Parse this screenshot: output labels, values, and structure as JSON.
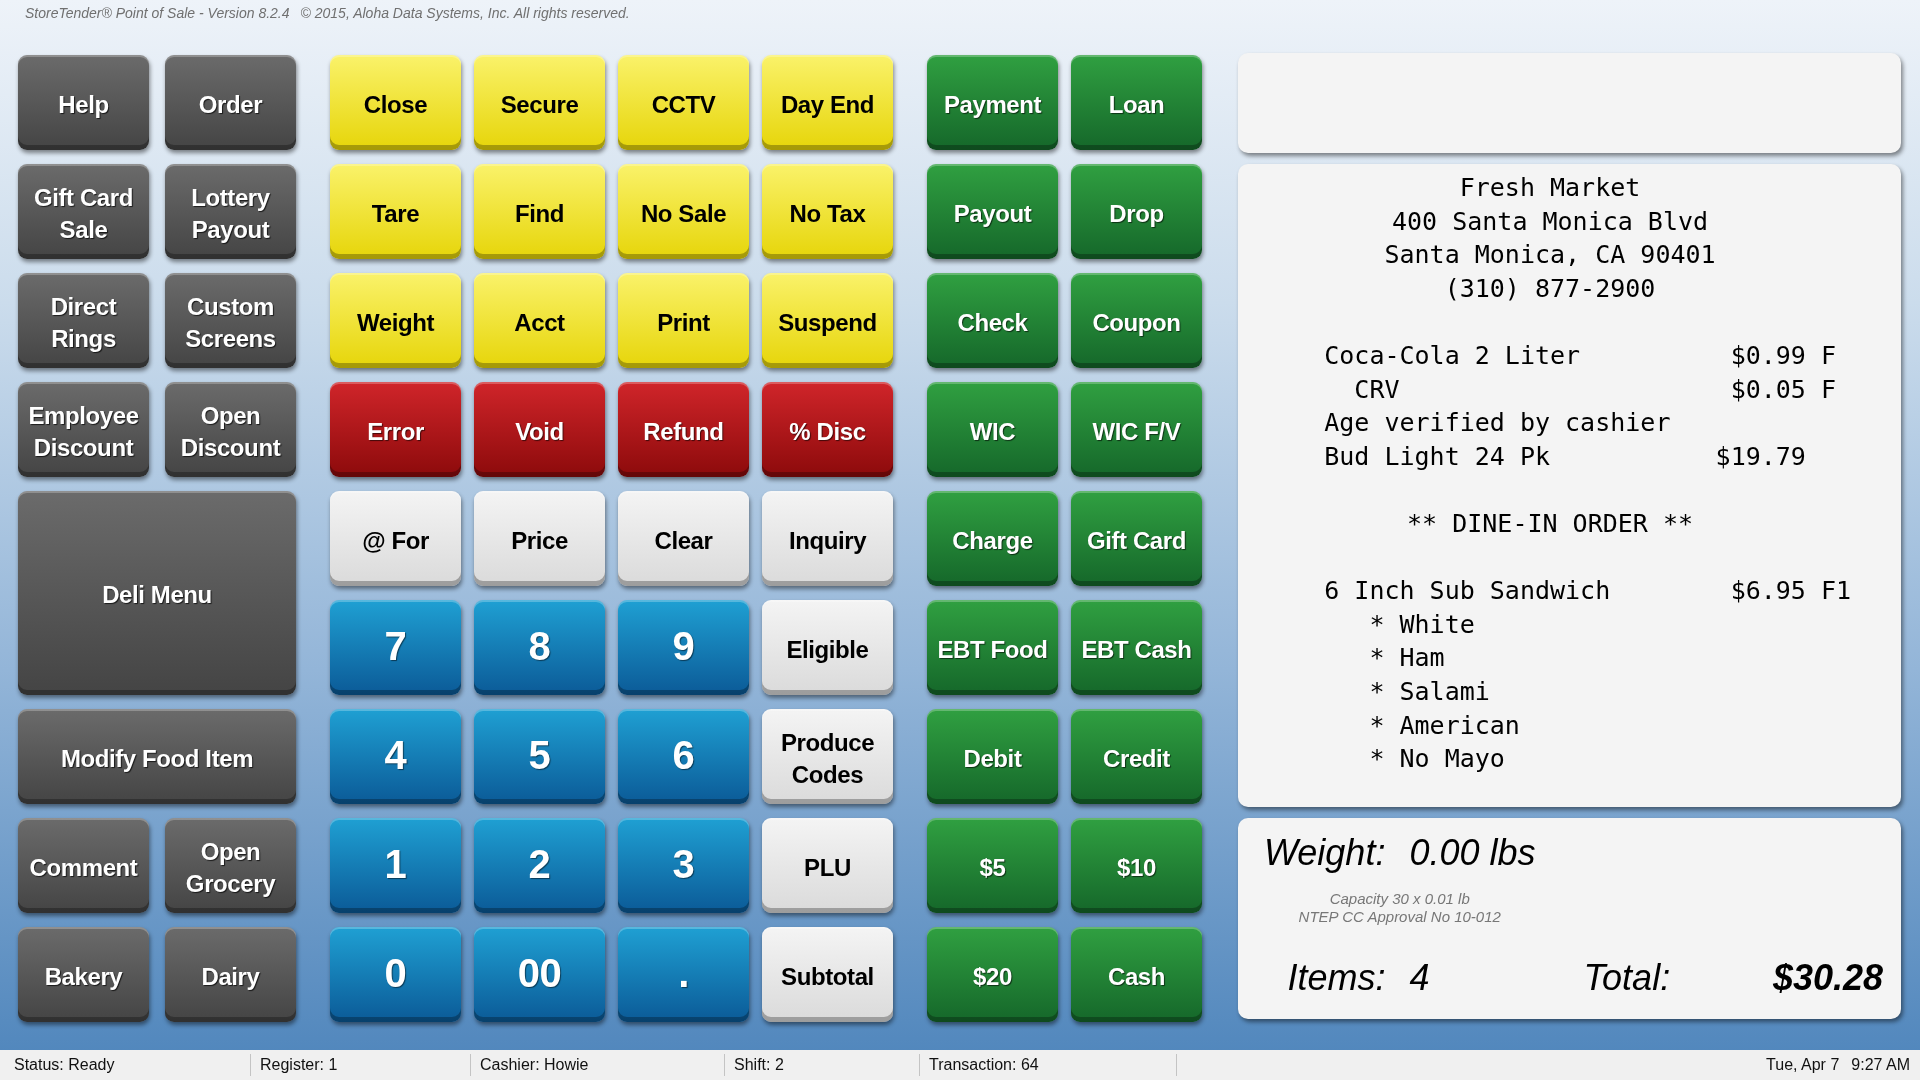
{
  "title_bar": {
    "title": "StoreTender® Point of Sale - Version 8.2.4",
    "copyright": "© 2015, Aloha Data Systems, Inc. All rights reserved."
  },
  "keypad": {
    "left": [
      {
        "label": "Help",
        "kind": "menu"
      },
      {
        "label": "Order",
        "kind": "menu"
      },
      {
        "label": "Gift Card Sale",
        "kind": "menu"
      },
      {
        "label": "Lottery Payout",
        "kind": "menu"
      },
      {
        "label": "Direct Rings",
        "kind": "menu"
      },
      {
        "label": "Custom Screens",
        "kind": "menu"
      },
      {
        "label": "Employee Discount",
        "kind": "menu"
      },
      {
        "label": "Open Discount",
        "kind": "menu"
      },
      {
        "label": "Deli Menu",
        "kind": "menu",
        "wide": true,
        "tall": true
      },
      {
        "label": "Modify Food Item",
        "kind": "menu",
        "wide": true,
        "tall": false
      },
      {
        "label": "Comment",
        "kind": "menu"
      },
      {
        "label": "Open Grocery",
        "kind": "menu"
      },
      {
        "label": "Bakery",
        "kind": "menu"
      },
      {
        "label": "Dairy",
        "kind": "menu"
      }
    ],
    "middle": [
      {
        "label": "Close",
        "kind": "control"
      },
      {
        "label": "Secure",
        "kind": "control"
      },
      {
        "label": "CCTV",
        "kind": "control"
      },
      {
        "label": "Day End",
        "kind": "control"
      },
      {
        "label": "Tare",
        "kind": "control"
      },
      {
        "label": "Find",
        "kind": "control"
      },
      {
        "label": "No Sale",
        "kind": "control"
      },
      {
        "label": "No Tax",
        "kind": "control"
      },
      {
        "label": "Weight",
        "kind": "control"
      },
      {
        "label": "Acct",
        "kind": "control"
      },
      {
        "label": "Print",
        "kind": "control"
      },
      {
        "label": "Suspend",
        "kind": "control"
      },
      {
        "label": "Error",
        "kind": "correction"
      },
      {
        "label": "Void",
        "kind": "correction"
      },
      {
        "label": "Refund",
        "kind": "correction"
      },
      {
        "label": "% Disc",
        "kind": "correction"
      },
      {
        "label": "@ For",
        "kind": "entry"
      },
      {
        "label": "Price",
        "kind": "entry"
      },
      {
        "label": "Clear",
        "kind": "entry"
      },
      {
        "label": "Inquiry",
        "kind": "entry"
      },
      {
        "label": "7",
        "kind": "digit"
      },
      {
        "label": "8",
        "kind": "digit"
      },
      {
        "label": "9",
        "kind": "digit"
      },
      {
        "label": "Eligible",
        "kind": "entry"
      },
      {
        "label": "4",
        "kind": "digit"
      },
      {
        "label": "5",
        "kind": "digit"
      },
      {
        "label": "6",
        "kind": "digit"
      },
      {
        "label": "Produce Codes",
        "kind": "entry"
      },
      {
        "label": "1",
        "kind": "digit"
      },
      {
        "label": "2",
        "kind": "digit"
      },
      {
        "label": "3",
        "kind": "digit"
      },
      {
        "label": "PLU",
        "kind": "entry"
      },
      {
        "label": "0",
        "kind": "digit"
      },
      {
        "label": "00",
        "kind": "digit"
      },
      {
        "label": ".",
        "kind": "digit"
      },
      {
        "label": "Subtotal",
        "kind": "entry"
      }
    ],
    "right": [
      {
        "label": "Payment",
        "kind": "tender"
      },
      {
        "label": "Loan",
        "kind": "tender"
      },
      {
        "label": "Payout",
        "kind": "tender"
      },
      {
        "label": "Drop",
        "kind": "tender"
      },
      {
        "label": "Check",
        "kind": "tender"
      },
      {
        "label": "Coupon",
        "kind": "tender"
      },
      {
        "label": "WIC",
        "kind": "tender"
      },
      {
        "label": "WIC F/V",
        "kind": "tender"
      },
      {
        "label": "Charge",
        "kind": "tender"
      },
      {
        "label": "Gift Card",
        "kind": "tender"
      },
      {
        "label": "EBT Food",
        "kind": "tender"
      },
      {
        "label": "EBT Cash",
        "kind": "tender"
      },
      {
        "label": "Debit",
        "kind": "tender"
      },
      {
        "label": "Credit",
        "kind": "tender"
      },
      {
        "label": "$5",
        "kind": "tender"
      },
      {
        "label": "$10",
        "kind": "tender"
      },
      {
        "label": "$20",
        "kind": "tender"
      },
      {
        "label": "Cash",
        "kind": "tender"
      }
    ]
  },
  "receipt": {
    "sections": [
      {
        "lines": [
          {
            "kind": "center",
            "text": "Fresh Market"
          },
          {
            "kind": "center",
            "text": "400 Santa Monica Blvd"
          },
          {
            "kind": "center",
            "text": "Santa Monica, CA 90401"
          },
          {
            "kind": "center",
            "text": "(310) 877-2900"
          }
        ]
      },
      {
        "lines": [
          {
            "kind": "item",
            "text": "Coca-Cola 2 Liter",
            "price": "$0.99",
            "tax": "F"
          },
          {
            "kind": "sub",
            "text": "CRV",
            "price": "$0.05",
            "tax": "F"
          },
          {
            "kind": "item",
            "text": "Age verified by cashier"
          },
          {
            "kind": "item",
            "text": "Bud Light 24 Pk",
            "price": "$19.79"
          }
        ]
      },
      {
        "lines": [
          {
            "kind": "center",
            "text": "** DINE-IN ORDER **"
          }
        ]
      },
      {
        "lines": [
          {
            "kind": "item",
            "text": "6 Inch Sub Sandwich",
            "price": "$6.95",
            "tax": "F1"
          },
          {
            "kind": "modifier",
            "text": "* White"
          },
          {
            "kind": "modifier",
            "text": "* Ham"
          },
          {
            "kind": "modifier",
            "text": "* Salami"
          },
          {
            "kind": "modifier",
            "text": "* American"
          },
          {
            "kind": "modifier",
            "text": "* No Mayo"
          }
        ]
      }
    ]
  },
  "scale_panel": {
    "weight_label": "Weight:",
    "weight": "0.00 lbs",
    "capacity": "Capacity 30 x 0.01 lb",
    "approval": "NTEP CC Approval No 10-012",
    "items_label": "Items:",
    "items": "4",
    "total_label": "Total:",
    "total": "$30.28"
  },
  "status_bar": {
    "cells": [
      "Status: Ready",
      "Register: 1",
      "Cashier: Howie",
      "Shift: 2",
      "Transaction: 64"
    ],
    "date": "Tue, Apr 7",
    "time": "9:27 AM"
  }
}
